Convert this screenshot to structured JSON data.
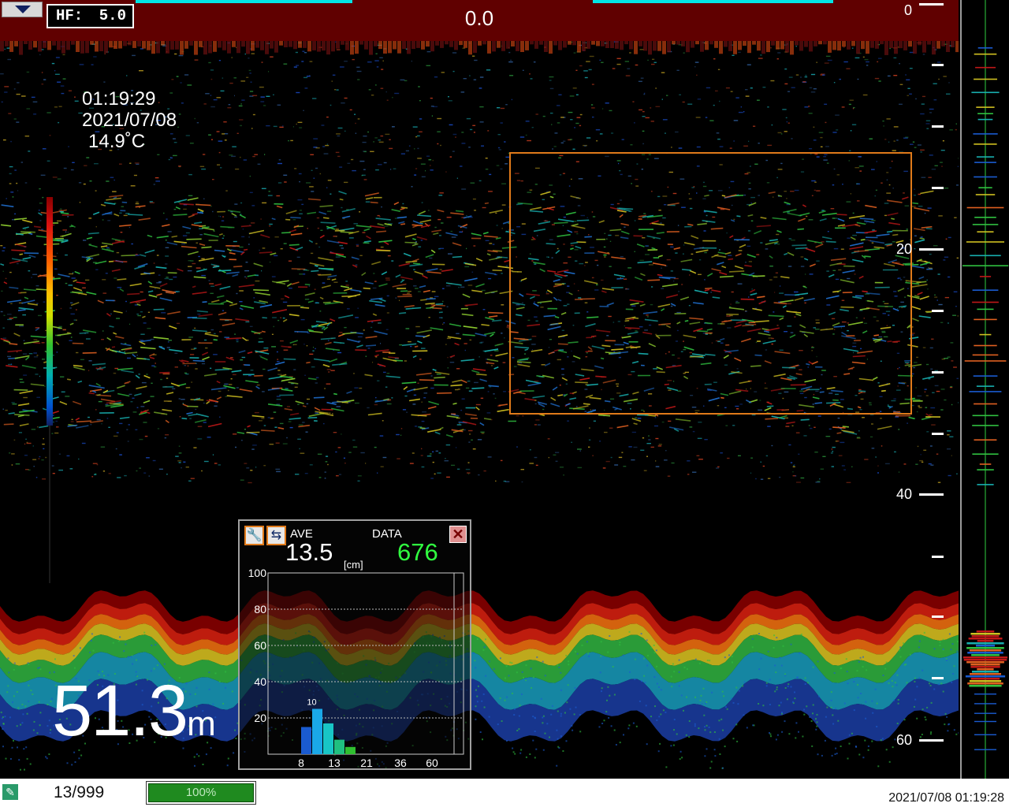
{
  "header": {
    "hf_label": "HF:",
    "hf_value": "5.0",
    "ship_speed": "0.0"
  },
  "overlay": {
    "time": "01:19:29",
    "date": "2021/07/08",
    "water_temp": "14.9˚C"
  },
  "depth_readout": {
    "value": "51.3",
    "unit": "m"
  },
  "depth_scale": [
    "0",
    "20",
    "40",
    "60"
  ],
  "histogram_panel": {
    "ave_label": "AVE",
    "ave_value": "13.5",
    "unit_label": "[cm]",
    "data_label": "DATA",
    "data_value": "676",
    "peak_label": "10",
    "y_ticks": [
      "100",
      "80",
      "60",
      "40",
      "20"
    ],
    "x_ticks": [
      "8",
      "13",
      "21",
      "36",
      "60"
    ],
    "bars": [
      {
        "value": 15,
        "color": "#1a5bd0"
      },
      {
        "value": 25,
        "color": "#1aa8e8"
      },
      {
        "value": 17,
        "color": "#18c6c6"
      },
      {
        "value": 8,
        "color": "#20c080"
      },
      {
        "value": 4,
        "color": "#30c030"
      }
    ]
  },
  "status_bar": {
    "file_count": "13/999",
    "progress_text": "100%",
    "progress_value": 100,
    "datetime": "2021/07/08 01:19:28"
  },
  "colors": {
    "header_bg": "#600000",
    "range_box": "#e07a1a",
    "data_value": "#30ff40"
  }
}
